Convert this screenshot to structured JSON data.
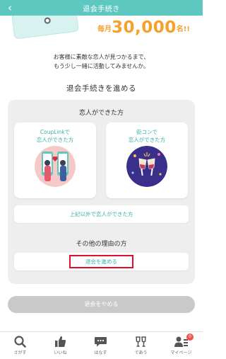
{
  "header": {
    "back_glyph": "‹",
    "title": "退会手続き"
  },
  "hero": {
    "prefix": "毎月",
    "number": "30,000",
    "suffix": "名!!"
  },
  "intro": {
    "line1": "お客様に素敵な恋人が見つかるまで、",
    "line2": "もう少し一緒に活動してみませんか。"
  },
  "section_title": "退会手続きを進める",
  "panel": {
    "found_title": "恋人ができた方",
    "cards": [
      {
        "line1": "CoupLinkで",
        "line2": "恋人ができた方",
        "icon": "couple-illustration"
      },
      {
        "line1": "街コンで",
        "line2": "恋人ができた方",
        "icon": "toast-illustration"
      }
    ],
    "other_found_button": "上記以外で恋人ができた方",
    "other_reasons_title": "その他の理由の方",
    "proceed_button": "退会を進める"
  },
  "cancel_button": "退会をやめる",
  "bottom_nav": [
    {
      "label": "さがす",
      "icon": "search-icon"
    },
    {
      "label": "いいね",
      "icon": "thumbs-up-icon"
    },
    {
      "label": "はなす",
      "icon": "chat-icon"
    },
    {
      "label": "であう",
      "icon": "toast-icon"
    },
    {
      "label": "マイページ",
      "icon": "profile-icon",
      "badge": "0"
    }
  ],
  "colors": {
    "header": "#5cc8c0",
    "accent_text": "#38b3aa",
    "hero_orange": "#f5a12b",
    "highlight_red": "#e0102b",
    "cancel_gray": "#c9c9c9",
    "badge_red": "#f0524b"
  }
}
